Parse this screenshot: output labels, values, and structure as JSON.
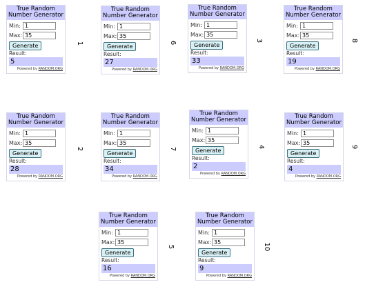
{
  "widgets": [
    {
      "title": "True Random Number Generator",
      "min_label": "Min:",
      "min": "1",
      "max_label": "Max:",
      "max": "35",
      "generate_label": "Generate",
      "result_label": "Result:",
      "result": "5",
      "powered_by": "Powered by ",
      "powered_link": "RANDOM.ORG",
      "side_number": "1"
    },
    {
      "title": "True Random Number Generator",
      "min_label": "Min:",
      "min": "1",
      "max_label": "Max:",
      "max": "35",
      "generate_label": "Generate",
      "result_label": "Result:",
      "result": "27",
      "powered_by": "Powered by ",
      "powered_link": "RANDOM.ORG",
      "side_number": "6"
    },
    {
      "title": "True Random Number Generator",
      "min_label": "Min:",
      "min": "1",
      "max_label": "Max:",
      "max": "35",
      "generate_label": "Generate",
      "result_label": "Result:",
      "result": "33",
      "powered_by": "Powered by ",
      "powered_link": "RANDOM.ORG",
      "side_number": "3"
    },
    {
      "title": "True Random Number Generator",
      "min_label": "Min:",
      "min": "1",
      "max_label": "Max:",
      "max": "35",
      "generate_label": "Generate",
      "result_label": "Result:",
      "result": "19",
      "powered_by": "Powered by ",
      "powered_link": "RANDOM.ORG",
      "side_number": "8"
    },
    {
      "title": "True Random Number Generator",
      "min_label": "Min:",
      "min": "1",
      "max_label": "Max:",
      "max": "35",
      "generate_label": "Generate",
      "result_label": "Result:",
      "result": "28",
      "powered_by": "Powered by ",
      "powered_link": "RANDOM.ORG",
      "side_number": "2"
    },
    {
      "title": "True Random Number Generator",
      "min_label": "Min:",
      "min": "1",
      "max_label": "Max:",
      "max": "35",
      "generate_label": "Generate",
      "result_label": "Result:",
      "result": "34",
      "powered_by": "Powered by ",
      "powered_link": "RANDOM.ORG",
      "side_number": "7"
    },
    {
      "title": "True Random Number Generator",
      "min_label": "Min:",
      "min": "1",
      "max_label": "Max:",
      "max": "35",
      "generate_label": "Generate",
      "result_label": "Result:",
      "result": "2",
      "powered_by": "Powered by ",
      "powered_link": "RANDOM.ORG",
      "side_number": "4"
    },
    {
      "title": "True Random Number Generator",
      "min_label": "Min:",
      "min": "1",
      "max_label": "Max:",
      "max": "35",
      "generate_label": "Generate",
      "result_label": "Result:",
      "result": "4",
      "powered_by": "Powered by ",
      "powered_link": "RANDOM.ORG",
      "side_number": "9"
    },
    {
      "title": "True Random Number Generator",
      "min_label": "Min:",
      "min": "1",
      "max_label": "Max:",
      "max": "35",
      "generate_label": "Generate",
      "result_label": "Result:",
      "result": "16",
      "powered_by": "Powered by ",
      "powered_link": "RANDOM.ORG",
      "side_number": "5"
    },
    {
      "title": "True Random Number Generator",
      "min_label": "Min:",
      "min": "1",
      "max_label": "Max:",
      "max": "35",
      "generate_label": "Generate",
      "result_label": "Result:",
      "result": "9",
      "powered_by": "Powered by ",
      "powered_link": "RANDOM.ORG",
      "side_number": "10"
    }
  ]
}
